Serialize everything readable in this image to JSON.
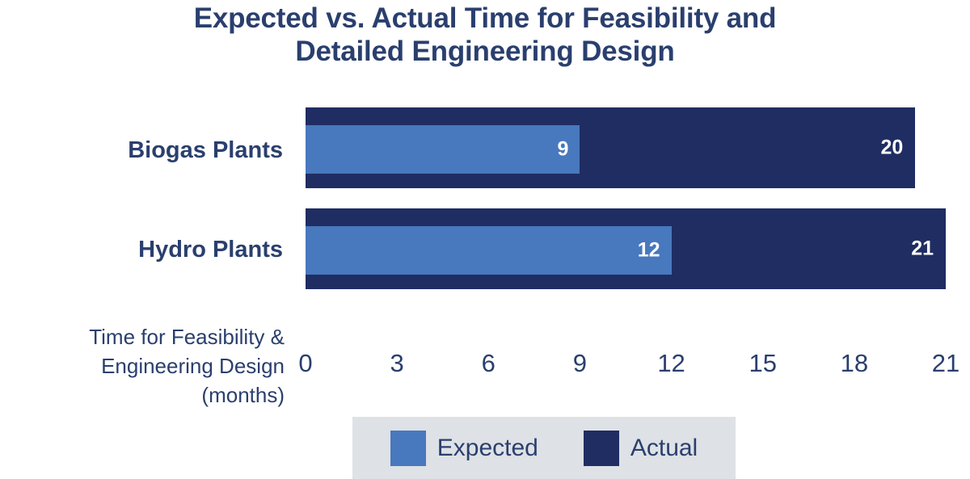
{
  "chart_data": {
    "type": "bar",
    "orientation": "horizontal",
    "overlapped": true,
    "title": "Expected vs. Actual Time for Feasibility and Detailed Engineering Design",
    "title_lines": [
      "Expected vs. Actual Time for Feasibility and",
      "Detailed Engineering Design"
    ],
    "categories": [
      "Biogas Plants",
      "Hydro Plants"
    ],
    "series": [
      {
        "name": "Expected",
        "values": [
          9,
          12
        ],
        "color": "#4878BE"
      },
      {
        "name": "Actual",
        "values": [
          20,
          21
        ],
        "color": "#1F2D62"
      }
    ],
    "xlabel": "Time for Feasibility & Engineering Design (months)",
    "xlabel_lines": [
      "Time for Feasibility &",
      "Engineering Design",
      "(months)"
    ],
    "ylabel": "",
    "xticks": [
      "0",
      "3",
      "6",
      "9",
      "12",
      "15",
      "18",
      "21"
    ],
    "xlim": [
      0,
      21
    ],
    "grid": false,
    "legend_position": "bottom",
    "legend": [
      {
        "label": "Expected",
        "color": "#4878BE"
      },
      {
        "label": "Actual",
        "color": "#1F2D62"
      }
    ],
    "data_labels": {
      "Biogas Plants": {
        "Expected": "9",
        "Actual": "20"
      },
      "Hydro Plants": {
        "Expected": "12",
        "Actual": "21"
      }
    },
    "colors": {
      "expected": "#4878BE",
      "actual": "#1F2D62",
      "text": "#2A3F6E",
      "data_label_text": "#FFFFFF",
      "legend_background": "#DEE1E5",
      "background": "#FFFFFF"
    }
  }
}
